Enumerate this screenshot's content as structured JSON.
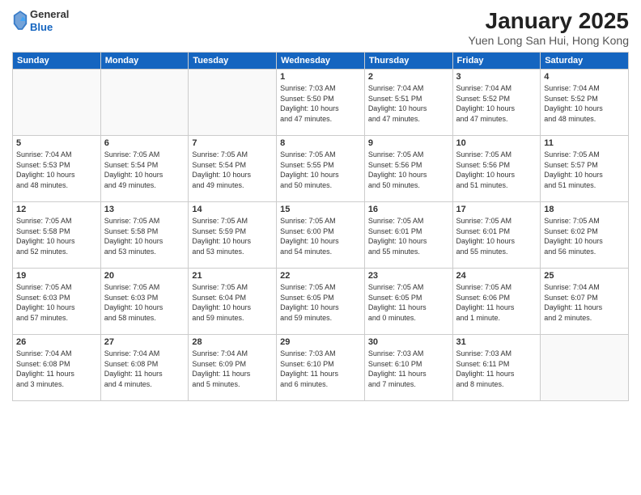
{
  "header": {
    "logo_general": "General",
    "logo_blue": "Blue",
    "month_title": "January 2025",
    "location": "Yuen Long San Hui, Hong Kong"
  },
  "weekdays": [
    "Sunday",
    "Monday",
    "Tuesday",
    "Wednesday",
    "Thursday",
    "Friday",
    "Saturday"
  ],
  "weeks": [
    [
      {
        "day": "",
        "info": ""
      },
      {
        "day": "",
        "info": ""
      },
      {
        "day": "",
        "info": ""
      },
      {
        "day": "1",
        "info": "Sunrise: 7:03 AM\nSunset: 5:50 PM\nDaylight: 10 hours\nand 47 minutes."
      },
      {
        "day": "2",
        "info": "Sunrise: 7:04 AM\nSunset: 5:51 PM\nDaylight: 10 hours\nand 47 minutes."
      },
      {
        "day": "3",
        "info": "Sunrise: 7:04 AM\nSunset: 5:52 PM\nDaylight: 10 hours\nand 47 minutes."
      },
      {
        "day": "4",
        "info": "Sunrise: 7:04 AM\nSunset: 5:52 PM\nDaylight: 10 hours\nand 48 minutes."
      }
    ],
    [
      {
        "day": "5",
        "info": "Sunrise: 7:04 AM\nSunset: 5:53 PM\nDaylight: 10 hours\nand 48 minutes."
      },
      {
        "day": "6",
        "info": "Sunrise: 7:05 AM\nSunset: 5:54 PM\nDaylight: 10 hours\nand 49 minutes."
      },
      {
        "day": "7",
        "info": "Sunrise: 7:05 AM\nSunset: 5:54 PM\nDaylight: 10 hours\nand 49 minutes."
      },
      {
        "day": "8",
        "info": "Sunrise: 7:05 AM\nSunset: 5:55 PM\nDaylight: 10 hours\nand 50 minutes."
      },
      {
        "day": "9",
        "info": "Sunrise: 7:05 AM\nSunset: 5:56 PM\nDaylight: 10 hours\nand 50 minutes."
      },
      {
        "day": "10",
        "info": "Sunrise: 7:05 AM\nSunset: 5:56 PM\nDaylight: 10 hours\nand 51 minutes."
      },
      {
        "day": "11",
        "info": "Sunrise: 7:05 AM\nSunset: 5:57 PM\nDaylight: 10 hours\nand 51 minutes."
      }
    ],
    [
      {
        "day": "12",
        "info": "Sunrise: 7:05 AM\nSunset: 5:58 PM\nDaylight: 10 hours\nand 52 minutes."
      },
      {
        "day": "13",
        "info": "Sunrise: 7:05 AM\nSunset: 5:58 PM\nDaylight: 10 hours\nand 53 minutes."
      },
      {
        "day": "14",
        "info": "Sunrise: 7:05 AM\nSunset: 5:59 PM\nDaylight: 10 hours\nand 53 minutes."
      },
      {
        "day": "15",
        "info": "Sunrise: 7:05 AM\nSunset: 6:00 PM\nDaylight: 10 hours\nand 54 minutes."
      },
      {
        "day": "16",
        "info": "Sunrise: 7:05 AM\nSunset: 6:01 PM\nDaylight: 10 hours\nand 55 minutes."
      },
      {
        "day": "17",
        "info": "Sunrise: 7:05 AM\nSunset: 6:01 PM\nDaylight: 10 hours\nand 55 minutes."
      },
      {
        "day": "18",
        "info": "Sunrise: 7:05 AM\nSunset: 6:02 PM\nDaylight: 10 hours\nand 56 minutes."
      }
    ],
    [
      {
        "day": "19",
        "info": "Sunrise: 7:05 AM\nSunset: 6:03 PM\nDaylight: 10 hours\nand 57 minutes."
      },
      {
        "day": "20",
        "info": "Sunrise: 7:05 AM\nSunset: 6:03 PM\nDaylight: 10 hours\nand 58 minutes."
      },
      {
        "day": "21",
        "info": "Sunrise: 7:05 AM\nSunset: 6:04 PM\nDaylight: 10 hours\nand 59 minutes."
      },
      {
        "day": "22",
        "info": "Sunrise: 7:05 AM\nSunset: 6:05 PM\nDaylight: 10 hours\nand 59 minutes."
      },
      {
        "day": "23",
        "info": "Sunrise: 7:05 AM\nSunset: 6:05 PM\nDaylight: 11 hours\nand 0 minutes."
      },
      {
        "day": "24",
        "info": "Sunrise: 7:05 AM\nSunset: 6:06 PM\nDaylight: 11 hours\nand 1 minute."
      },
      {
        "day": "25",
        "info": "Sunrise: 7:04 AM\nSunset: 6:07 PM\nDaylight: 11 hours\nand 2 minutes."
      }
    ],
    [
      {
        "day": "26",
        "info": "Sunrise: 7:04 AM\nSunset: 6:08 PM\nDaylight: 11 hours\nand 3 minutes."
      },
      {
        "day": "27",
        "info": "Sunrise: 7:04 AM\nSunset: 6:08 PM\nDaylight: 11 hours\nand 4 minutes."
      },
      {
        "day": "28",
        "info": "Sunrise: 7:04 AM\nSunset: 6:09 PM\nDaylight: 11 hours\nand 5 minutes."
      },
      {
        "day": "29",
        "info": "Sunrise: 7:03 AM\nSunset: 6:10 PM\nDaylight: 11 hours\nand 6 minutes."
      },
      {
        "day": "30",
        "info": "Sunrise: 7:03 AM\nSunset: 6:10 PM\nDaylight: 11 hours\nand 7 minutes."
      },
      {
        "day": "31",
        "info": "Sunrise: 7:03 AM\nSunset: 6:11 PM\nDaylight: 11 hours\nand 8 minutes."
      },
      {
        "day": "",
        "info": ""
      }
    ]
  ]
}
